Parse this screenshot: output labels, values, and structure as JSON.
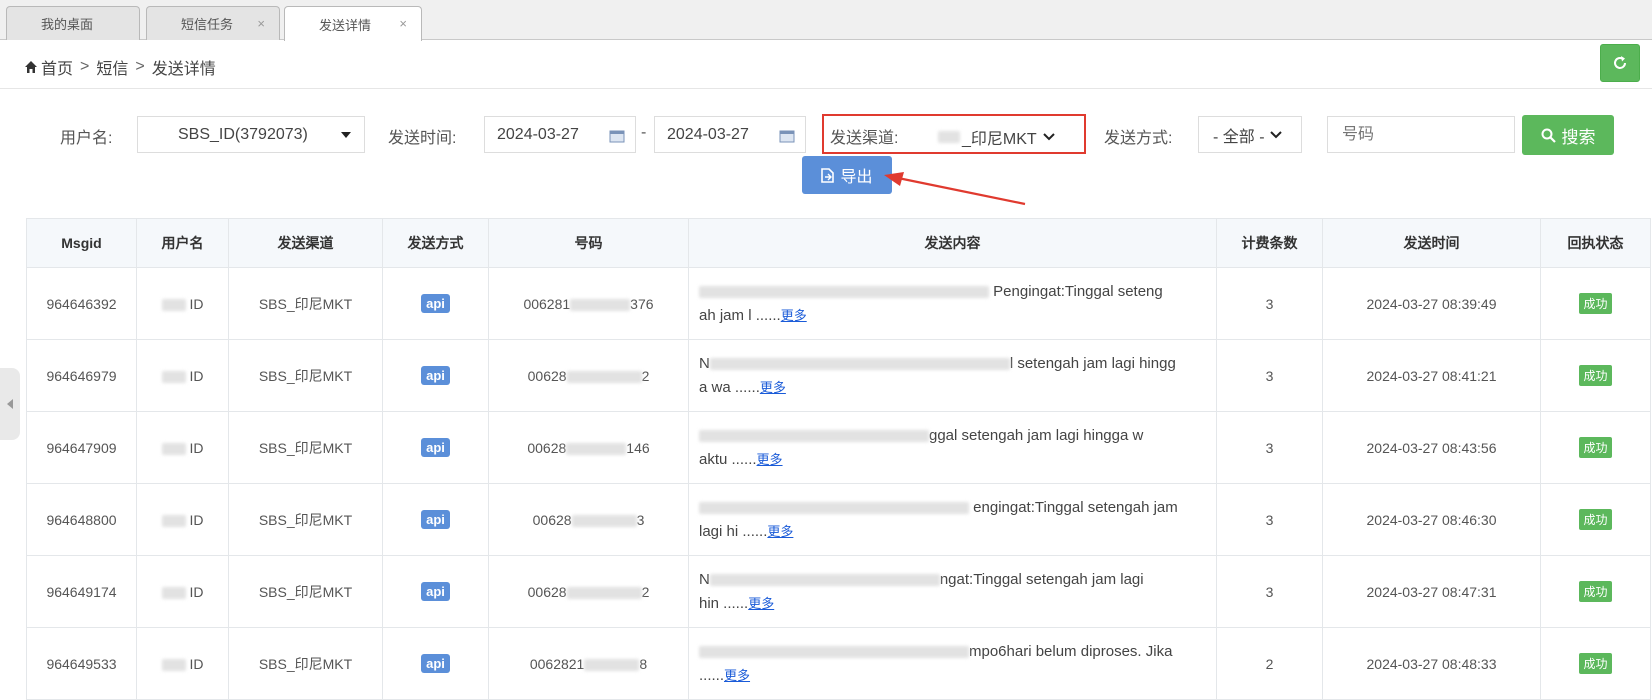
{
  "tabs": [
    {
      "label": "我的桌面",
      "close": ""
    },
    {
      "label": "短信任务",
      "close": "×"
    },
    {
      "label": "发送详情",
      "close": "×"
    }
  ],
  "breadcrumb": {
    "home": "首页",
    "sep": ">",
    "level1": "短信",
    "level2": "发送详情"
  },
  "filters": {
    "username_label": "用户名:",
    "username_value": "SBS_ID(3792073)",
    "time_label": "发送时间:",
    "date_from": "2024-03-27",
    "date_dash": "-",
    "date_to": "2024-03-27",
    "channel_label": "发送渠道:",
    "channel_value": "_印尼MKT",
    "method_label": "发送方式:",
    "method_value": "- 全部 -",
    "number_placeholder": "号码",
    "search_label": "搜索",
    "export_label": "导出"
  },
  "colors": {
    "green": "#5cb85c",
    "blue": "#5b8fd9",
    "red": "#e03a2f"
  },
  "table": {
    "headers": [
      "Msgid",
      "用户名",
      "发送渠道",
      "发送方式",
      "号码",
      "发送内容",
      "计费条数",
      "发送时间",
      "回执状态"
    ],
    "more_label": "更多",
    "rows": [
      {
        "msgid": "964646392",
        "user": "ID",
        "channel": "SBS_印尼MKT",
        "method": "api",
        "number_a": "006281",
        "number_b": "376",
        "content_a": "Pengingat:Tinggal seteng",
        "content_b": "ah jam l ......",
        "count": "3",
        "time": "2024-03-27 08:39:49",
        "status": "成功"
      },
      {
        "msgid": "964646979",
        "user": "ID",
        "channel": "SBS_印尼MKT",
        "method": "api",
        "number_a": "00628",
        "number_b": "2",
        "content_a": "N",
        "content_c": "l setengah jam lagi hingg",
        "content_b": "a wa ......",
        "count": "3",
        "time": "2024-03-27 08:41:21",
        "status": "成功"
      },
      {
        "msgid": "964647909",
        "user": "ID",
        "channel": "SBS_印尼MKT",
        "method": "api",
        "number_a": "00628",
        "number_b": "146",
        "content_a": "ggal setengah jam lagi hingga w",
        "content_b": "aktu ......",
        "count": "3",
        "time": "2024-03-27 08:43:56",
        "status": "成功"
      },
      {
        "msgid": "964648800",
        "user": "ID",
        "channel": "SBS_印尼MKT",
        "method": "api",
        "number_a": "00628",
        "number_b": "3",
        "content_a": "engingat:Tinggal setengah jam",
        "content_b": "lagi hi ......",
        "count": "3",
        "time": "2024-03-27 08:46:30",
        "status": "成功"
      },
      {
        "msgid": "964649174",
        "user": "ID",
        "channel": "SBS_印尼MKT",
        "method": "api",
        "number_a": "00628",
        "number_b": "2",
        "content_a": "N",
        "content_c": "ngat:Tinggal setengah jam lagi",
        "content_b": "hin ......",
        "count": "3",
        "time": "2024-03-27 08:47:31",
        "status": "成功"
      },
      {
        "msgid": "964649533",
        "user": "ID",
        "channel": "SBS_印尼MKT",
        "method": "api",
        "number_a": "0062821",
        "number_b": "8",
        "content_a": "mpo6hari belum diproses. Jika",
        "content_b": "......",
        "count": "2",
        "time": "2024-03-27 08:48:33",
        "status": "成功"
      }
    ]
  }
}
